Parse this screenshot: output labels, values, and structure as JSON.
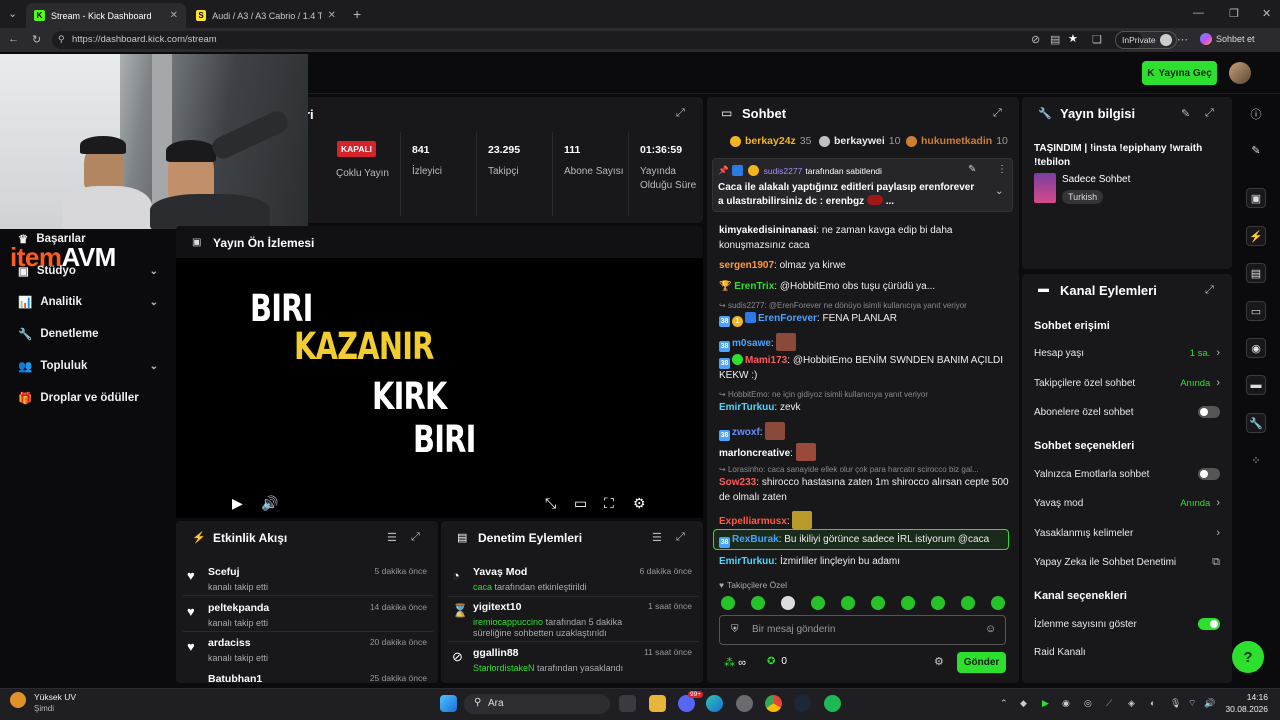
{
  "browser": {
    "tabs": [
      {
        "label": "Stream - Kick Dashboard",
        "active": true,
        "favicon": "K"
      },
      {
        "label": "Audi / A3 / A3 Cabrio / 1.4 TFSI / ...",
        "active": false,
        "favicon": "S"
      }
    ],
    "url": "https://dashboard.kick.com/stream",
    "inprivate_label": "InPrivate",
    "copilot_label": "Sohbet et"
  },
  "topbar": {
    "go_live_label": "Yayına Geç"
  },
  "webcam_overlay": {
    "logo_left": "item",
    "logo_right": "AVM"
  },
  "nav": {
    "items": [
      {
        "label": "Başarılar"
      },
      {
        "label": "Stüdyo"
      },
      {
        "label": "Analitik"
      },
      {
        "label": "Denetleme"
      },
      {
        "label": "Topluluk"
      },
      {
        "label": "Droplar ve ödüller"
      }
    ]
  },
  "stream_info_panel": {
    "title_fragment": "ri",
    "status_badge": "KAPALI",
    "status_label": "Çoklu Yayın",
    "stats": [
      {
        "value": "841",
        "label": "İzleyici"
      },
      {
        "value": "23.295",
        "label": "Takipçi"
      },
      {
        "value": "111",
        "label": "Abone Sayısı"
      },
      {
        "value": "01:36:59",
        "label": "Yayında Olduğu Süre"
      }
    ]
  },
  "preview": {
    "title": "Yayın Ön İzlemesi",
    "lines": [
      "BIRI",
      "KAZANIR",
      "KIRK",
      "BIRI"
    ],
    "line_colors": [
      "#ffffff",
      "#f2cd2f",
      "#ffffff",
      "#ffffff"
    ]
  },
  "activity": {
    "title": "Etkinlik Akışı",
    "items": [
      {
        "name": "Scefuj",
        "sub": "kanalı takip etti",
        "time": "5 dakika önce"
      },
      {
        "name": "peltekpanda",
        "sub": "kanalı takip etti",
        "time": "14 dakika önce"
      },
      {
        "name": "ardaciss",
        "sub": "kanalı takip etti",
        "time": "20 dakika önce"
      },
      {
        "name": "Batubhan1",
        "sub": "",
        "time": "25 dakika önce"
      }
    ]
  },
  "moderation": {
    "title": "Denetim Eylemleri",
    "items": [
      {
        "name": "Yavaş Mod",
        "actor": "caca",
        "sub": "tarafından etkinleştirildi",
        "time": "6 dakika önce"
      },
      {
        "name": "yigitext10",
        "actor": "iremiocappuccino",
        "sub": "tarafından 5 dakika süreliğine sohbetten uzaklaştırıldı",
        "time": "1 saat önce"
      },
      {
        "name": "ggallin88",
        "actor": "StarlordistakeN",
        "sub": "tarafından yasaklandı",
        "time": "11 saat önce"
      }
    ]
  },
  "chat": {
    "title": "Sohbet",
    "leaderboard": [
      {
        "name": "berkay24z",
        "count": "35",
        "color": "#f2b51f"
      },
      {
        "name": "berkaywei",
        "count": "10",
        "color": "#c0c0c0"
      },
      {
        "name": "hukumetkadin",
        "count": "10",
        "color": "#cd7f32"
      }
    ],
    "pinned": {
      "by": "sudis2277",
      "by_suffix": "tarafından sabitlendi",
      "text": "Caca ile alakalı yaptığınız editleri paylasıp erenforever a ulastırabilirsiniz dc : erenbgz",
      "ellipsis": "..."
    },
    "messages": [
      {
        "user": "kimyakedisininanasi",
        "color": "#ffffff",
        "text": "ne zaman kavga edip bi daha konuşmazsınız caca"
      },
      {
        "user": "sergen1907",
        "color": "#ff9a3c",
        "text": "olmaz ya kirwe"
      },
      {
        "user": "ErenTrix",
        "color": "#2de02d",
        "text": "@HobbitEmo obs tuşu çürüdü ya..."
      },
      {
        "reply": "sudis2277: @ErenForever ne dönüyo isimli kullanıcıya yanıt veriyor"
      },
      {
        "user": "ErenForever",
        "color": "#4aa3ff",
        "text": "FENA PLANLAR"
      },
      {
        "user": "m0sawe",
        "color": "#4aa3ff",
        "text": ""
      },
      {
        "user": "Mami173",
        "color": "#ff5a5a",
        "text": "@HobbitEmo BENİM SWNDEN BANIM AÇILDI KEKW :)"
      },
      {
        "reply": "HobbitEmo: ne için gidiyoz isimli kullanıcıya yanıt veriyor"
      },
      {
        "user": "EmirTurkuu",
        "color": "#4ad8ff",
        "text": "zevk"
      },
      {
        "user": "zwoxf",
        "color": "#6a8cff",
        "text": ""
      },
      {
        "user": "marloncreative",
        "color": "#ffffff",
        "text": ""
      },
      {
        "reply": "Lorasinho: caca sanayide ellek olur çok para harcatır scirocco biz gal..."
      },
      {
        "user": "Sow233",
        "color": "#ff5a5a",
        "text": "shirocco hastasına zaten 1m shirocco alırsan cepte 500 de olmalı zaten"
      },
      {
        "user": "Expelliarmusx",
        "color": "#ff5a3c",
        "text": ""
      },
      {
        "user": "RexBurak",
        "color": "#4aa3ff",
        "text": "Bu ikiliyi görünce sadece İRL istiyorum @caca"
      },
      {
        "user": "EmirTurkuu",
        "color": "#4ad8ff",
        "text": "İzmirliler linçleyin bu adamı"
      }
    ],
    "followers_only_label": "Takipçilere Özel",
    "input_placeholder": "Bir mesaj gönderin",
    "points_value": "0",
    "send_label": "Gönder"
  },
  "stream_info": {
    "title": "Yayın bilgisi",
    "stream_title": "TAŞINDIM | !insta !epiphany !wraith !tebilon",
    "category": "Sadece Sohbet",
    "tag": "Turkish"
  },
  "channel_actions": {
    "title": "Kanal Eylemleri",
    "chat_access_title": "Sohbet erişimi",
    "chat_access_rows": [
      {
        "label": "Hesap yaşı",
        "value": "1 sa.",
        "type": "chevron"
      },
      {
        "label": "Takipçilere özel sohbet",
        "value": "Anında",
        "type": "chevron"
      },
      {
        "label": "Abonelere özel sohbet",
        "value": "",
        "type": "toggle",
        "on": false
      }
    ],
    "chat_options_title": "Sohbet seçenekleri",
    "chat_options_rows": [
      {
        "label": "Yalnızca Emotlarla sohbet",
        "value": "",
        "type": "toggle",
        "on": false
      },
      {
        "label": "Yavaş mod",
        "value": "Anında",
        "type": "chevron"
      },
      {
        "label": "Yasaklanmış kelimeler",
        "value": "",
        "type": "chevron"
      },
      {
        "label": "Yapay Zeka ile Sohbet Denetimi",
        "value": "",
        "type": "external"
      }
    ],
    "channel_options_title": "Kanal seçenekleri",
    "channel_options_rows": [
      {
        "label": "İzlenme sayısını göster",
        "value": "",
        "type": "toggle",
        "on": true
      },
      {
        "label": "Raid Kanalı",
        "value": "",
        "type": "none"
      }
    ]
  },
  "taskbar": {
    "notification_title": "Yüksek UV",
    "notification_sub": "Şimdi",
    "search_label": "Ara",
    "time": "14:16",
    "date": "30.08.2026",
    "badge_count": "99+"
  },
  "colors": {
    "accent": "#2de02d",
    "panel": "#18181b",
    "background": "#0b0b0d"
  }
}
